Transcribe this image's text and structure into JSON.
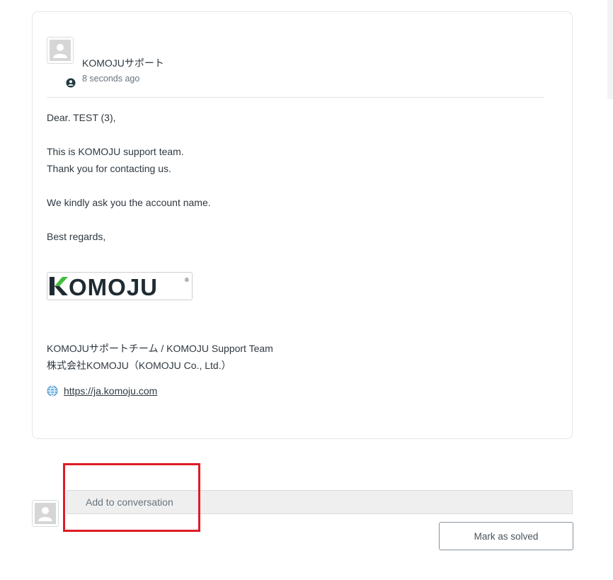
{
  "comment": {
    "author": "KOMOJUサポート",
    "timestamp": "8 seconds ago",
    "author_avatar_icon": "default-avatar-icon",
    "role_icon": "user-circle-icon",
    "body": {
      "greeting": "Dear. TEST (3),",
      "line1": "This is KOMOJU support team.",
      "line2": "Thank you for contacting us.",
      "line3": "We kindly ask you the account name.",
      "closing": "Best regards,"
    },
    "logo": {
      "text_k": "K",
      "text_rest": "OMOJU",
      "registered": "®",
      "green": "#3fbf3f",
      "dark": "#1f2b33"
    },
    "signature": {
      "team": "KOMOJUサポートチーム / KOMOJU Support Team",
      "company": "株式会社KOMOJU（KOMOJU Co., Ltd.）",
      "link_icon": "globe-icon",
      "link": "https://ja.komoju.com"
    }
  },
  "composer": {
    "avatar_icon": "default-avatar-icon",
    "placeholder": "Add to conversation",
    "solve_button_label": "Mark as solved"
  },
  "colors": {
    "highlight": "#e01b24",
    "text": "#2f3941",
    "muted": "#68737d",
    "composer_bg": "#efefef"
  }
}
